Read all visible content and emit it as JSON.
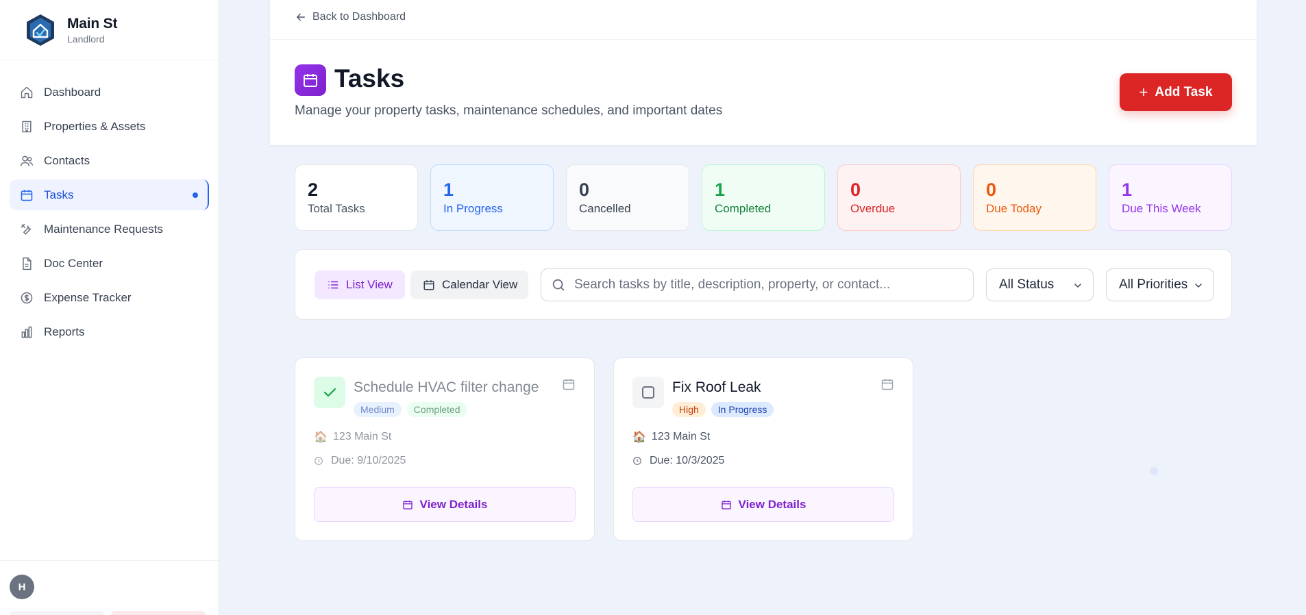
{
  "brand": {
    "name": "Main St",
    "role": "Landlord"
  },
  "nav": {
    "items": [
      {
        "label": "Dashboard",
        "icon": "home-icon"
      },
      {
        "label": "Properties & Assets",
        "icon": "building-icon"
      },
      {
        "label": "Contacts",
        "icon": "users-icon"
      },
      {
        "label": "Tasks",
        "icon": "calendar-icon",
        "active": true
      },
      {
        "label": "Maintenance Requests",
        "icon": "tools-icon"
      },
      {
        "label": "Doc Center",
        "icon": "document-icon"
      },
      {
        "label": "Expense Tracker",
        "icon": "dollar-icon"
      },
      {
        "label": "Reports",
        "icon": "bar-chart-icon"
      }
    ]
  },
  "user": {
    "initial": "H"
  },
  "header": {
    "back_label": "Back to Dashboard",
    "title": "Tasks",
    "subtitle": "Manage your property tasks, maintenance schedules, and important dates",
    "add_label": "Add Task"
  },
  "stats": [
    {
      "value": "2",
      "label": "Total Tasks",
      "color": "#111827",
      "label_color": "#4b5563",
      "bg": "#ffffff",
      "border": "#e5e7eb"
    },
    {
      "value": "1",
      "label": "In Progress",
      "color": "#2563eb",
      "label_color": "#2563eb",
      "bg": "#eff6ff",
      "border": "#bfdbfe"
    },
    {
      "value": "0",
      "label": "Cancelled",
      "color": "#374151",
      "label_color": "#374151",
      "bg": "#f9fafb",
      "border": "#e5e7eb"
    },
    {
      "value": "1",
      "label": "Completed",
      "color": "#16a34a",
      "label_color": "#15803d",
      "bg": "#f0fdf4",
      "border": "#bbf7d0"
    },
    {
      "value": "0",
      "label": "Overdue",
      "color": "#dc2626",
      "label_color": "#dc2626",
      "bg": "#fef2f2",
      "border": "#fecaca"
    },
    {
      "value": "0",
      "label": "Due Today",
      "color": "#ea580c",
      "label_color": "#ea580c",
      "bg": "#fff7ed",
      "border": "#fed7aa"
    },
    {
      "value": "1",
      "label": "Due This Week",
      "color": "#9333ea",
      "label_color": "#9333ea",
      "bg": "#faf5ff",
      "border": "#e9d5ff"
    }
  ],
  "filters": {
    "list_view_label": "List View",
    "calendar_view_label": "Calendar View",
    "search_placeholder": "Search tasks by title, description, property, or contact...",
    "status_value": "All Status",
    "priority_value": "All Priorities"
  },
  "tasks": [
    {
      "title": "Schedule HVAC filter change",
      "priority": "Medium",
      "status": "Completed",
      "property": "123 Main St",
      "due": "Due: 9/10/2025",
      "completed": true,
      "details_label": "View Details"
    },
    {
      "title": "Fix Roof Leak",
      "priority": "High",
      "status": "In Progress",
      "property": "123 Main St",
      "due": "Due: 10/3/2025",
      "completed": false,
      "details_label": "View Details"
    }
  ],
  "colors": {
    "accent": "#7e22ce",
    "primary_action": "#dc2626",
    "nav_active": "#2563eb"
  }
}
